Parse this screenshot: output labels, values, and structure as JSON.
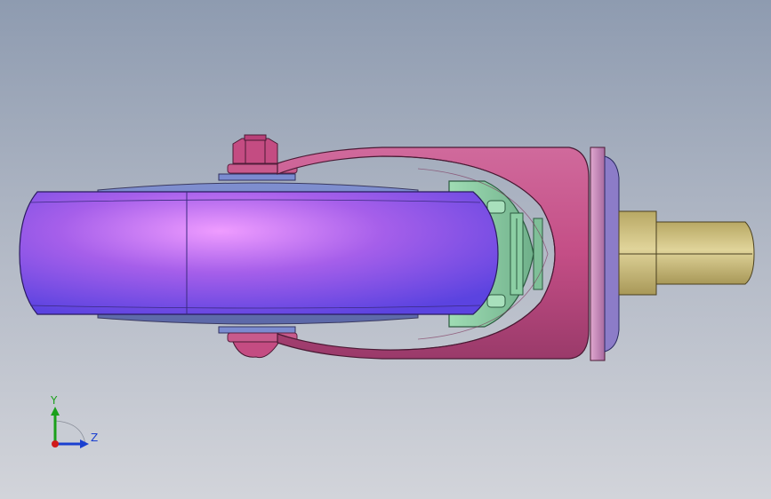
{
  "triad": {
    "y_label": "Y",
    "z_label": "Z",
    "y_color": "#1aa01a",
    "z_color": "#1a3fd0",
    "x_color": "#d01a1a"
  },
  "colors": {
    "wheel": "#9a5ae6",
    "wheel_highlight": "#e88cff",
    "wheel_dark": "#5a4ae0",
    "fork": "#c9528c",
    "fork_dark": "#8a2a5e",
    "bracket": "#8ccfa4",
    "stem": "#c8b870",
    "plate": "#d28cc0",
    "bolt": "#c24a7a",
    "disc": "#6c7cc0"
  }
}
